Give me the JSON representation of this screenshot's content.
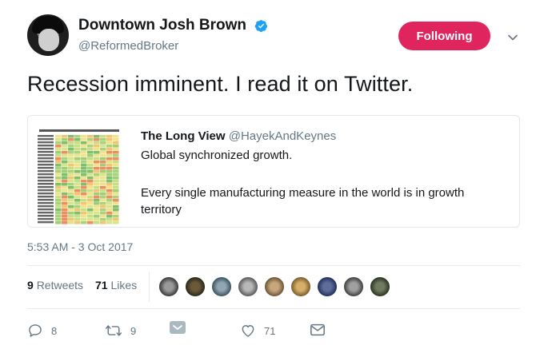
{
  "author": {
    "name": "Downtown Josh Brown",
    "handle": "@ReformedBroker",
    "verified": true
  },
  "follow_button": {
    "label": "Following",
    "color": "#e0245e"
  },
  "tweet": {
    "text": "Recession imminent. I read it on Twitter."
  },
  "quoted_tweet": {
    "author_name": "The Long View",
    "author_handle": "@HayekAndKeynes",
    "text_line1": "Global synchronized growth.",
    "text_line2": "Every single manufacturing measure in the world is in growth territory",
    "thumbnail_icon": "heatmap-table-thumbnail"
  },
  "timestamp": "5:53 AM - 3 Oct 2017",
  "stats": {
    "retweets_count": "9",
    "retweets_label": "Retweets",
    "likes_count": "71",
    "likes_label": "Likes"
  },
  "actions": {
    "reply_count": "8",
    "retweet_count": "9",
    "like_count": "71"
  },
  "colors": {
    "text_primary": "#14171a",
    "text_secondary": "#657786",
    "verified_blue": "#1da1f2",
    "border": "#e1e8ed"
  }
}
